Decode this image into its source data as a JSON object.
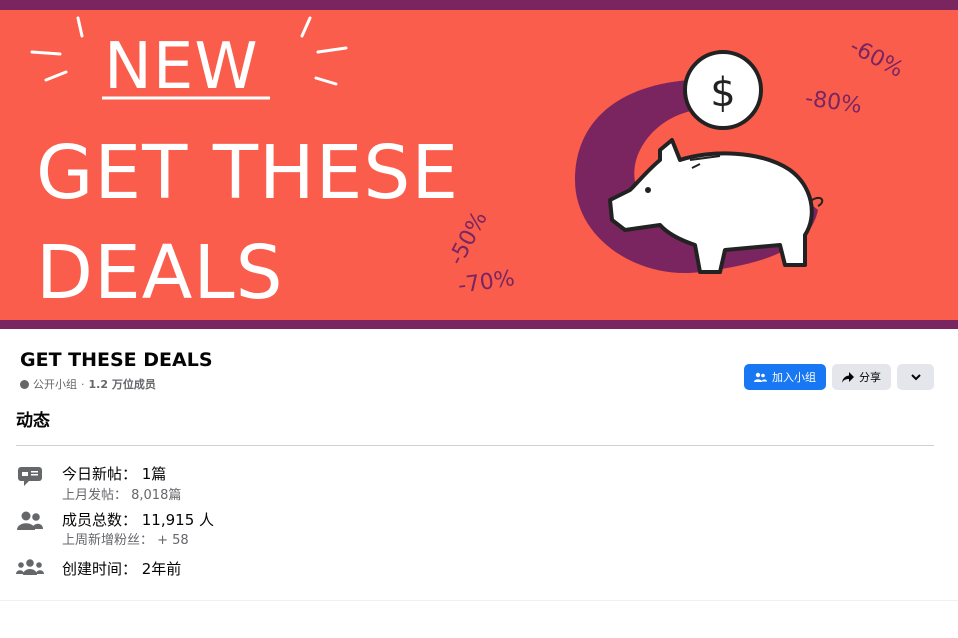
{
  "banner": {
    "headline_new": "NEW",
    "headline_line1": "GET THESE",
    "headline_line2": "DEALS",
    "percents": [
      "-60%",
      "-80%",
      "-50%",
      "-70%"
    ],
    "colors": {
      "background": "#fa5d4c",
      "accent": "#7a2560",
      "text": "#ffffff"
    }
  },
  "group": {
    "title": "GET THESE DEALS",
    "privacy": "公开小组",
    "separator": "·",
    "member_count": "1.2 万位成员"
  },
  "actions": {
    "join_label": "加入小组",
    "share_label": "分享",
    "join_color": "#1877f2"
  },
  "activity": {
    "heading": "动态",
    "posts_today": "今日新帖： 1篇",
    "posts_last_month": "上月发帖： 8,018篇",
    "total_members": "成员总数： 11,915 人",
    "new_followers_last_week": "上周新增粉丝： + 58",
    "created": "创建时间： 2年前"
  },
  "icons": {
    "posts": "chat-bubble-icon",
    "members": "people-icon",
    "created": "group-icon",
    "globe": "globe-icon",
    "join": "add-group-icon",
    "share": "share-arrow-icon",
    "more": "chevron-down-icon"
  }
}
